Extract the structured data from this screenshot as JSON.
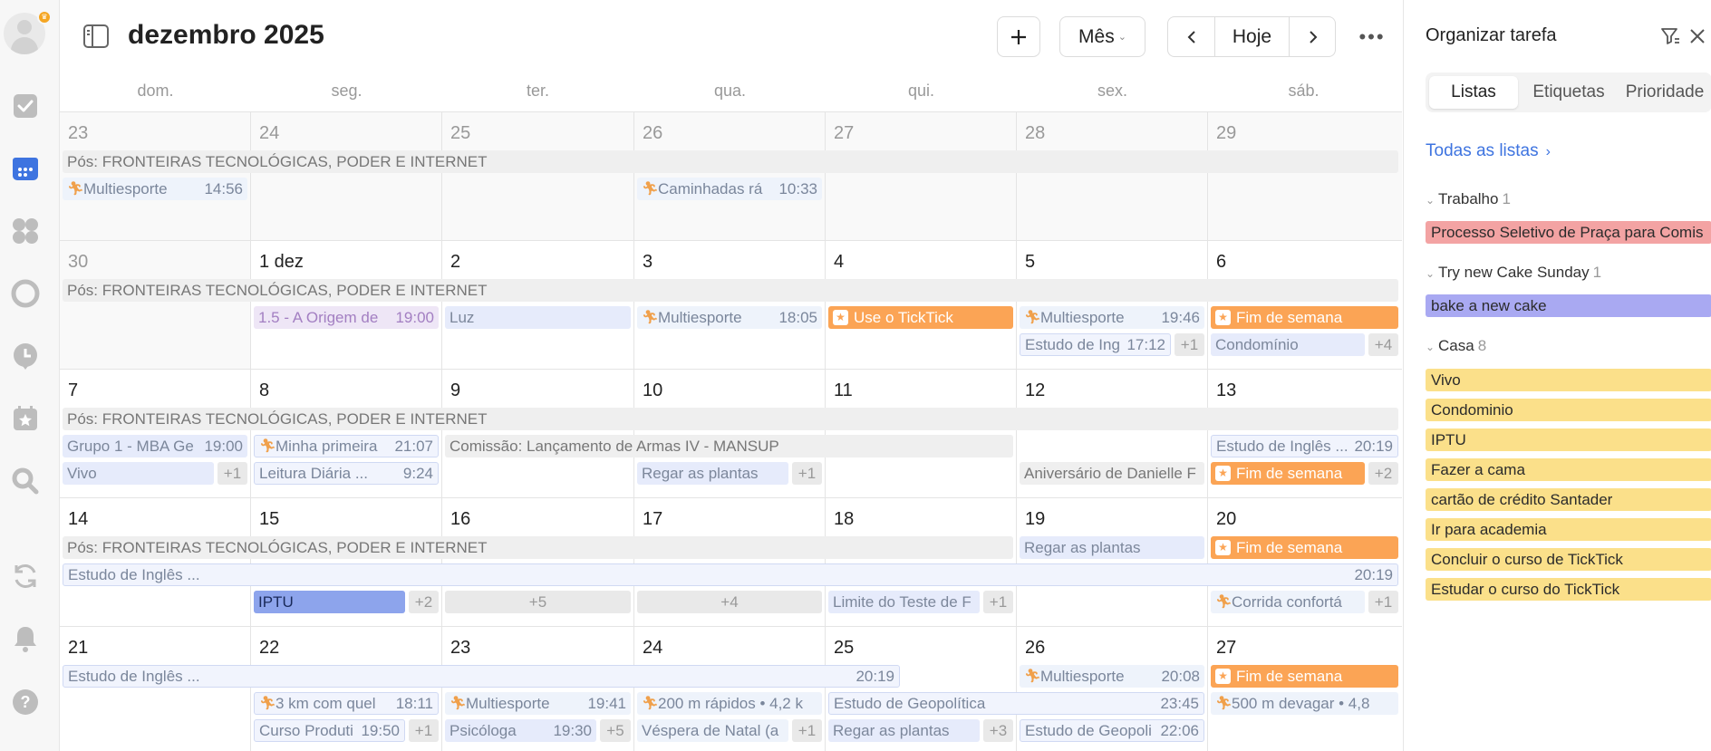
{
  "header": {
    "title": "dezembro 2025",
    "view_label": "Mês",
    "today_label": "Hoje"
  },
  "weekdays": [
    "dom.",
    "seg.",
    "ter.",
    "qua.",
    "qui.",
    "sex.",
    "sáb."
  ],
  "weeks": [
    {
      "days": [
        "23",
        "24",
        "25",
        "26",
        "27",
        "28",
        "29"
      ]
    },
    {
      "days": [
        "30",
        "1 dez",
        "2",
        "3",
        "4",
        "5",
        "6"
      ]
    },
    {
      "days": [
        "7",
        "8",
        "9",
        "10",
        "11",
        "12",
        "13"
      ]
    },
    {
      "days": [
        "14",
        "15",
        "16",
        "17",
        "18",
        "19",
        "20"
      ]
    },
    {
      "days": [
        "21",
        "22",
        "23",
        "24",
        "25",
        "26",
        "27"
      ]
    }
  ],
  "events": {
    "pos": "Pós: FRONTEIRAS TECNOLÓGICAS, PODER E INTERNET",
    "w0": [
      {
        "t": "Multiesporte",
        "tm": "14:56"
      },
      {
        "t": "Caminhadas rá",
        "tm": "10:33"
      }
    ],
    "w1": [
      {
        "t": "1.5 - A Origem de",
        "tm": "19:00"
      },
      {
        "t": "Luz"
      },
      {
        "t": "Multiesporte",
        "tm": "18:05"
      },
      {
        "t": "Use o TickTick"
      },
      {
        "t": "Multiesporte",
        "tm": "19:46"
      },
      {
        "t": "Fim de semana"
      },
      {
        "t": "Estudo de Ing",
        "tm": "17:12"
      },
      {
        "t": "+1"
      },
      {
        "t": "Condomínio"
      },
      {
        "t": "+4"
      }
    ],
    "w2": [
      {
        "t": "Grupo 1 - MBA Ge",
        "tm": "19:00"
      },
      {
        "t": "Minha primeira",
        "tm": "21:07"
      },
      {
        "t": "Comissão: Lançamento de Armas IV - MANSUP"
      },
      {
        "t": "Estudo de Inglês ...",
        "tm": "20:19"
      },
      {
        "t": "Vivo"
      },
      {
        "t": "+1"
      },
      {
        "t": "Leitura Diária ...",
        "tm": "9:24"
      },
      {
        "t": "Regar as plantas"
      },
      {
        "t": "+1"
      },
      {
        "t": "Aniversário de Danielle F"
      },
      {
        "t": "Fim de semana"
      },
      {
        "t": "+2"
      }
    ],
    "w3": [
      {
        "t": "Regar as plantas"
      },
      {
        "t": "Fim de semana"
      },
      {
        "t": "Estudo de Inglês ...",
        "tm": "20:19"
      },
      {
        "t": "IPTU"
      },
      {
        "t": "+2"
      },
      {
        "t": "+5"
      },
      {
        "t": "+4"
      },
      {
        "t": "Limite do Teste de F"
      },
      {
        "t": "+1"
      },
      {
        "t": "Corrida confortá"
      },
      {
        "t": "+1"
      }
    ],
    "w4": [
      {
        "t": "Estudo de Inglês ...",
        "tm": "20:19"
      },
      {
        "t": "Multiesporte",
        "tm": "20:08"
      },
      {
        "t": "Fim de semana"
      },
      {
        "t": "3 km com quel",
        "tm": "18:11"
      },
      {
        "t": "Multiesporte",
        "tm": "19:41"
      },
      {
        "t": "200 m rápidos • 4,2 k"
      },
      {
        "t": "Estudo de Geopolítica",
        "tm": "23:45"
      },
      {
        "t": "500 m devagar • 4,8"
      },
      {
        "t": "Curso Produti",
        "tm": "19:50"
      },
      {
        "t": "+1"
      },
      {
        "t": "Psicóloga",
        "tm": "19:30"
      },
      {
        "t": "+5"
      },
      {
        "t": "Véspera de Natal (a"
      },
      {
        "t": "+1"
      },
      {
        "t": "Regar as plantas"
      },
      {
        "t": "+3"
      },
      {
        "t": "Estudo de Geopoli",
        "tm": "22:06"
      }
    ]
  },
  "right_panel": {
    "title": "Organizar tarefa",
    "tabs": [
      "Listas",
      "Etiquetas",
      "Prioridade"
    ],
    "all_lists": "Todas as listas",
    "groups": [
      {
        "name": "Trabalho",
        "count": "1",
        "color": "#f3a3a3",
        "tasks": [
          "Processo Seletivo de Praça para Comis"
        ]
      },
      {
        "name": "Try new Cake Sunday",
        "count": "1",
        "color": "#a9a9f2",
        "tasks": [
          "bake a new cake"
        ]
      },
      {
        "name": "Casa",
        "count": "8",
        "color": "#fbe08a",
        "tasks": [
          "Vivo",
          "Condominio",
          "IPTU",
          "Fazer a cama",
          "cartão de crédito Santader",
          "Ir para academia",
          "Concluir o curso de TickTick",
          "Estudar o curso do TickTick"
        ]
      }
    ]
  },
  "icons": {
    "rail": [
      "tasks-icon",
      "calendar-icon",
      "apps-icon",
      "focus-icon",
      "clock-icon",
      "star-calendar-icon",
      "search-icon",
      "sync-icon",
      "bell-icon",
      "help-icon"
    ],
    "run": "runner-icon",
    "star": "star-badge-icon"
  },
  "colors": {
    "accent": "#3e74e0",
    "orange": "#fba455",
    "active_rail": "#3e74e0"
  }
}
